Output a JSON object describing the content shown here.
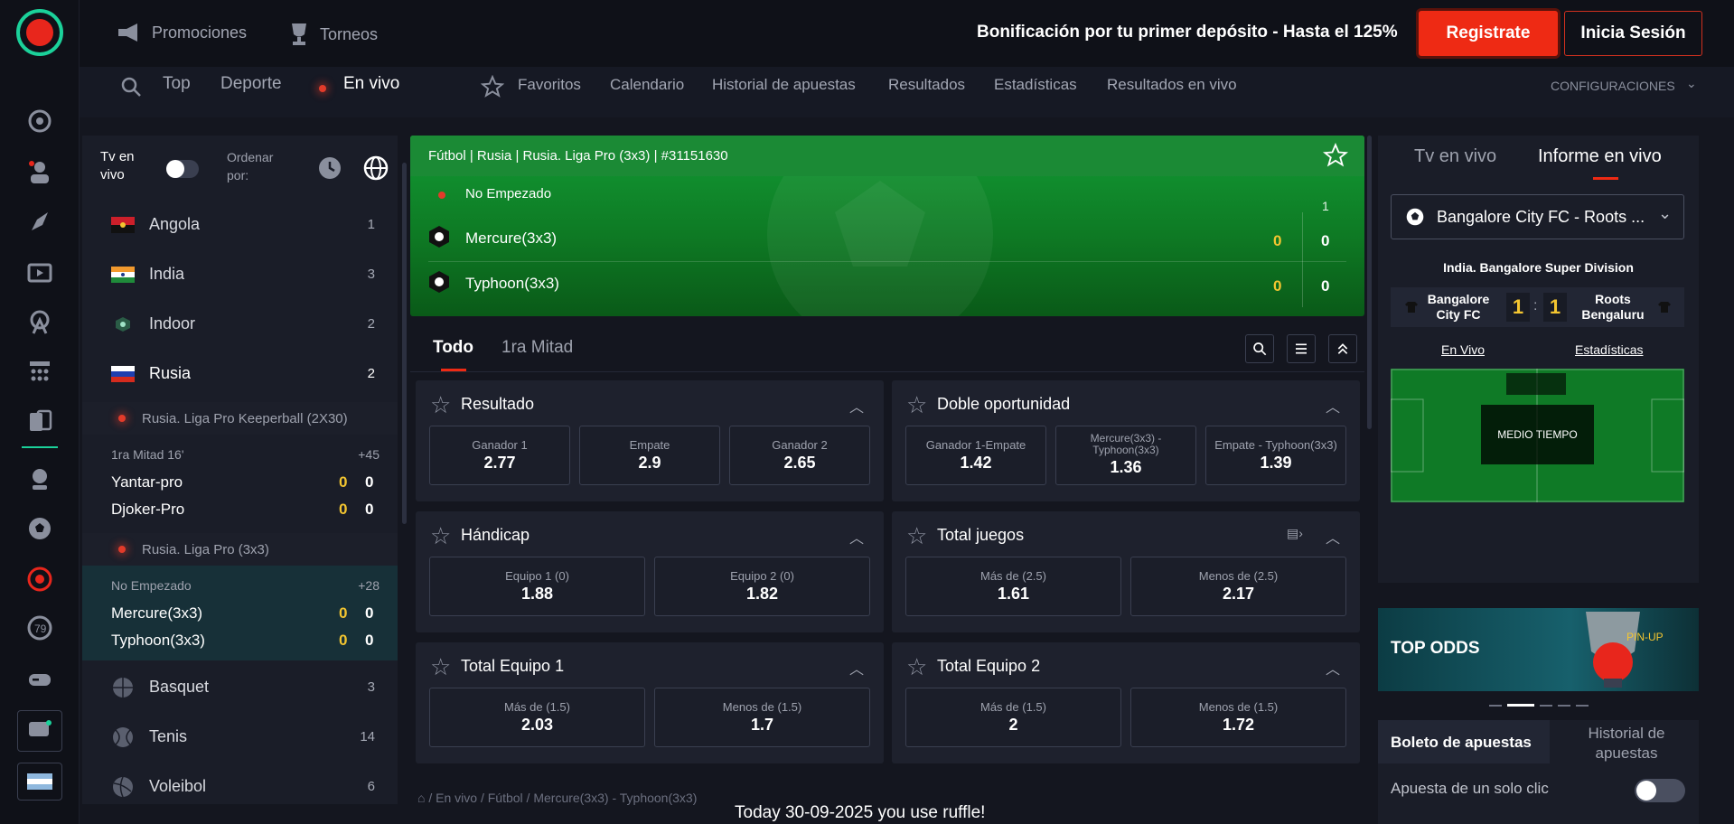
{
  "topbar": {
    "promotions": "Promociones",
    "tournaments": "Torneos",
    "bonus_text": "Bonificación por tu primer depósito - Hasta el 125%",
    "register": "Registrate",
    "login": "Inicia Sesión"
  },
  "subnav": {
    "top": "Top",
    "sport": "Deporte",
    "live": "En vivo",
    "favorites": "Favoritos",
    "calendar": "Calendario",
    "bet_history": "Historial de apuestas",
    "results": "Resultados",
    "stats": "Estadísticas",
    "live_results": "Resultados en vivo",
    "settings": "CONFIGURACIONES"
  },
  "left": {
    "tv_live": "Tv en vivo",
    "sort_by": "Ordenar por:",
    "countries": [
      {
        "name": "Angola",
        "count": "1"
      },
      {
        "name": "India",
        "count": "3"
      },
      {
        "name": "Indoor",
        "count": "2"
      },
      {
        "name": "Rusia",
        "count": "2"
      }
    ],
    "league1": "Rusia. Liga Pro Keeperball (2X30)",
    "match1": {
      "status": "1ra Mitad 16'",
      "more": "+45",
      "team1": "Yantar-pro",
      "team2": "Djoker-Pro",
      "t1s1": "0",
      "t1s2": "0",
      "t2s1": "0",
      "t2s2": "0"
    },
    "league2": "Rusia. Liga Pro (3x3)",
    "match2": {
      "status": "No Empezado",
      "more": "+28",
      "team1": "Mercure(3x3)",
      "team2": "Typhoon(3x3)",
      "t1s1": "0",
      "t1s2": "0",
      "t2s1": "0",
      "t2s2": "0"
    },
    "sports": [
      {
        "name": "Basquet",
        "count": "3"
      },
      {
        "name": "Tenis",
        "count": "14"
      },
      {
        "name": "Voleibol",
        "count": "6"
      }
    ]
  },
  "match": {
    "breadcrumb": "Fútbol | Rusia | Rusia. Liga Pro (3x3) | #31151630",
    "status": "No Empezado",
    "period_col": "1",
    "team1": "Mercure(3x3)",
    "team2": "Typhoon(3x3)",
    "t1_score": "0",
    "t1_period": "0",
    "t2_score": "0",
    "t2_period": "0"
  },
  "tabs": {
    "all": "Todo",
    "first_half": "1ra Mitad"
  },
  "markets": [
    {
      "title": "Resultado",
      "odds": [
        {
          "label": "Ganador 1",
          "value": "2.77"
        },
        {
          "label": "Empate",
          "value": "2.9"
        },
        {
          "label": "Ganador 2",
          "value": "2.65"
        }
      ]
    },
    {
      "title": "Doble oportunidad",
      "odds": [
        {
          "label": "Ganador 1-Empate",
          "value": "1.42"
        },
        {
          "label": "Mercure(3x3) - Typhoon(3x3)",
          "value": "1.36"
        },
        {
          "label": "Empate - Typhoon(3x3)",
          "value": "1.39"
        }
      ]
    },
    {
      "title": "Hándicap",
      "odds": [
        {
          "label": "Equipo 1 (0)",
          "value": "1.88"
        },
        {
          "label": "Equipo 2 (0)",
          "value": "1.82"
        }
      ]
    },
    {
      "title": "Total juegos",
      "odds": [
        {
          "label": "Más de (2.5)",
          "value": "1.61"
        },
        {
          "label": "Menos de (2.5)",
          "value": "2.17"
        }
      ]
    },
    {
      "title": "Total Equipo 1",
      "odds": [
        {
          "label": "Más de (1.5)",
          "value": "2.03"
        },
        {
          "label": "Menos de (1.5)",
          "value": "1.7"
        }
      ]
    },
    {
      "title": "Total Equipo 2",
      "odds": [
        {
          "label": "Más de (1.5)",
          "value": "2"
        },
        {
          "label": "Menos de (1.5)",
          "value": "1.72"
        }
      ]
    }
  ],
  "breadcrumb": {
    "live": "En vivo",
    "football": "Fútbol",
    "match": "Mercure(3x3) - Typhoon(3x3)"
  },
  "right": {
    "tab_tv": "Tv en vivo",
    "tab_report": "Informe en vivo",
    "selected_match": "Bangalore City FC - Roots ...",
    "league": "India. Bangalore Super Division",
    "home": "Bangalore City FC",
    "away": "Roots Bengaluru",
    "home_score": "1",
    "away_score": "1",
    "link_live": "En Vivo",
    "link_stats": "Estadísticas",
    "pitch_label": "MEDIO TIEMPO"
  },
  "banner": {
    "text": "TOP ODDS"
  },
  "betslip": {
    "tab_slip": "Boleto de apuestas",
    "tab_history": "Historial de apuestas",
    "one_click": "Apuesta de un solo clic"
  },
  "footer_note": "Today 30-09-2025 you use ruffle!",
  "colors": {
    "accent_red": "#ee2a14",
    "score_yellow": "#f3c530",
    "pitch_green": "#0f7a26",
    "logo_teal": "#1bd19a"
  }
}
